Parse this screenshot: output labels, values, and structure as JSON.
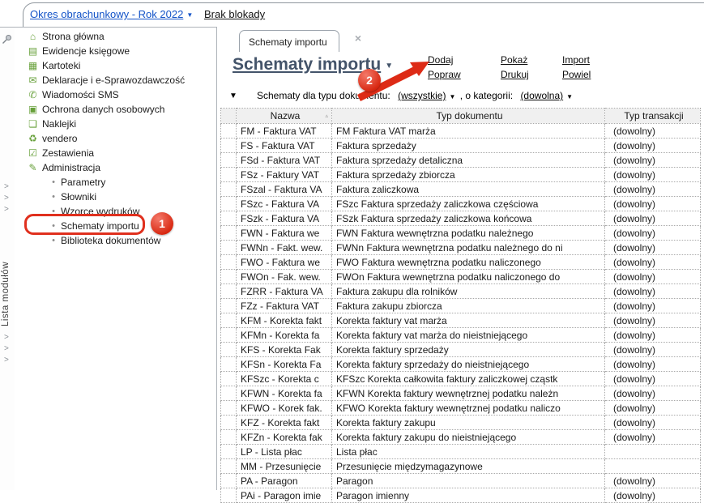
{
  "colors": {
    "accent_red": "#e0301e",
    "link_blue": "#1353c8",
    "title_slate": "#44546a",
    "icon_green": "#67a03a",
    "header_gray": "#f0f0f0",
    "border_gray": "#aeb3b9"
  },
  "icons": {
    "caret_down": "▼",
    "chevron": ">",
    "close": "×",
    "sort_asc": "▵",
    "bullet": "•"
  },
  "top_bar": {
    "period_link": "Okres obrachunkowy - Rok 2022",
    "lock_link": "Brak blokady"
  },
  "module_strip": {
    "label": "Lista modułów"
  },
  "sidebar": {
    "items": [
      {
        "label": "Strona główna",
        "icon": "⌂",
        "icon_name": "home-icon"
      },
      {
        "label": "Ewidencje księgowe",
        "icon": "▤",
        "icon_name": "ledger-icon"
      },
      {
        "label": "Kartoteki",
        "icon": "▦",
        "icon_name": "card-index-icon"
      },
      {
        "label": "Deklaracje i e-Sprawozdawczość",
        "icon": "✉",
        "icon_name": "declarations-icon"
      },
      {
        "label": "Wiadomości SMS",
        "icon": "✆",
        "icon_name": "sms-icon"
      },
      {
        "label": "Ochrona danych osobowych",
        "icon": "▣",
        "icon_name": "data-protection-icon"
      },
      {
        "label": "Naklejki",
        "icon": "❏",
        "icon_name": "labels-icon"
      },
      {
        "label": "vendero",
        "icon": "♻",
        "icon_name": "vendero-icon"
      },
      {
        "label": "Zestawienia",
        "icon": "☑",
        "icon_name": "reports-icon"
      },
      {
        "label": "Administracja",
        "icon": "✎",
        "icon_name": "administration-icon"
      },
      {
        "label": "Parametry",
        "icon": "•",
        "icon_name": "bullet-icon",
        "variant": "sub"
      },
      {
        "label": "Słowniki",
        "icon": "•",
        "icon_name": "bullet-icon",
        "variant": "sub"
      },
      {
        "label": "Wzorce wydruków",
        "icon": "•",
        "icon_name": "bullet-icon",
        "variant": "sub"
      },
      {
        "label": "Schematy importu",
        "icon": "•",
        "icon_name": "bullet-icon",
        "variant": "sub"
      },
      {
        "label": "Biblioteka dokumentów",
        "icon": "•",
        "icon_name": "bullet-icon",
        "variant": "sub"
      }
    ]
  },
  "tab": {
    "label": "Schematy importu"
  },
  "page": {
    "title": "Schematy importu"
  },
  "actions": {
    "add": "Dodaj",
    "edit": "Popraw",
    "show": "Pokaż",
    "print": "Drukuj",
    "import": "Import",
    "duplicate": "Powiel"
  },
  "filter": {
    "prefix": "Schematy dla typu dokumentu:",
    "doc_type_value": "(wszystkie)",
    "middle": ", o kategorii:",
    "category_value": "(dowolna)"
  },
  "table": {
    "columns": {
      "name": "Nazwa",
      "doc_type": "Typ dokumentu",
      "trans_type": "Typ transakcji"
    },
    "rows": [
      {
        "name": "FM - Faktura VAT",
        "doc_type": "FM Faktura VAT marża",
        "trans_type": "(dowolny)"
      },
      {
        "name": "FS - Faktura VAT",
        "doc_type": "Faktura sprzedaży",
        "trans_type": "(dowolny)"
      },
      {
        "name": "FSd - Faktura VAT",
        "doc_type": "Faktura sprzedaży detaliczna",
        "trans_type": "(dowolny)"
      },
      {
        "name": "FSz - Faktury VAT",
        "doc_type": "Faktura sprzedaży zbiorcza",
        "trans_type": "(dowolny)"
      },
      {
        "name": "FSzal - Faktura VA",
        "doc_type": "Faktura zaliczkowa",
        "trans_type": "(dowolny)"
      },
      {
        "name": "FSzc - Faktura VA",
        "doc_type": "FSzc Faktura sprzedaży zaliczkowa częściowa",
        "trans_type": "(dowolny)"
      },
      {
        "name": "FSzk - Faktura VA",
        "doc_type": "FSzk Faktura sprzedaży zaliczkowa końcowa",
        "trans_type": "(dowolny)"
      },
      {
        "name": "FWN - Faktura we",
        "doc_type": "FWN Faktura wewnętrzna podatku należnego",
        "trans_type": "(dowolny)"
      },
      {
        "name": "FWNn - Fakt. wew.",
        "doc_type": "FWNn Faktura wewnętrzna podatku należnego do ni",
        "trans_type": "(dowolny)"
      },
      {
        "name": "FWO - Faktura we",
        "doc_type": "FWO Faktura wewnętrzna podatku naliczonego",
        "trans_type": "(dowolny)"
      },
      {
        "name": "FWOn - Fak. wew.",
        "doc_type": "FWOn Faktura wewnętrzna podatku naliczonego do",
        "trans_type": "(dowolny)"
      },
      {
        "name": "FZRR - Faktura VA",
        "doc_type": "Faktura zakupu dla rolników",
        "trans_type": "(dowolny)"
      },
      {
        "name": "FZz - Faktura VAT",
        "doc_type": "Faktura zakupu zbiorcza",
        "trans_type": "(dowolny)"
      },
      {
        "name": "KFM - Korekta fakt",
        "doc_type": "Korekta faktury vat marża",
        "trans_type": "(dowolny)"
      },
      {
        "name": "KFMn - Korekta fa",
        "doc_type": "Korekta faktury vat marża do nieistniejącego",
        "trans_type": "(dowolny)"
      },
      {
        "name": "KFS - Korekta Fak",
        "doc_type": "Korekta faktury sprzedaży",
        "trans_type": "(dowolny)"
      },
      {
        "name": "KFSn - Korekta Fa",
        "doc_type": "Korekta faktury sprzedaży do nieistniejącego",
        "trans_type": "(dowolny)"
      },
      {
        "name": "KFSzc - Korekta c",
        "doc_type": "KFSzc Korekta całkowita faktury zaliczkowej cząstk",
        "trans_type": "(dowolny)"
      },
      {
        "name": "KFWN - Korekta fa",
        "doc_type": "KFWN Korekta faktury wewnętrznej podatku należn",
        "trans_type": "(dowolny)"
      },
      {
        "name": "KFWO - Korek fak.",
        "doc_type": "KFWO Korekta faktury wewnętrznej podatku naliczo",
        "trans_type": "(dowolny)"
      },
      {
        "name": "KFZ - Korekta fakt",
        "doc_type": "Korekta faktury zakupu",
        "trans_type": "(dowolny)"
      },
      {
        "name": "KFZn - Korekta fak",
        "doc_type": "Korekta faktury zakupu do nieistniejącego",
        "trans_type": "(dowolny)"
      },
      {
        "name": "LP - Lista płac",
        "doc_type": "Lista płac",
        "trans_type": ""
      },
      {
        "name": "MM - Przesunięcie",
        "doc_type": "Przesunięcie międzymagazynowe",
        "trans_type": ""
      },
      {
        "name": "PA - Paragon",
        "doc_type": "Paragon",
        "trans_type": "(dowolny)"
      },
      {
        "name": "PAi - Paragon imie",
        "doc_type": "Paragon imienny",
        "trans_type": "(dowolny)"
      }
    ]
  },
  "annotations": {
    "step1": "1",
    "step2": "2"
  }
}
